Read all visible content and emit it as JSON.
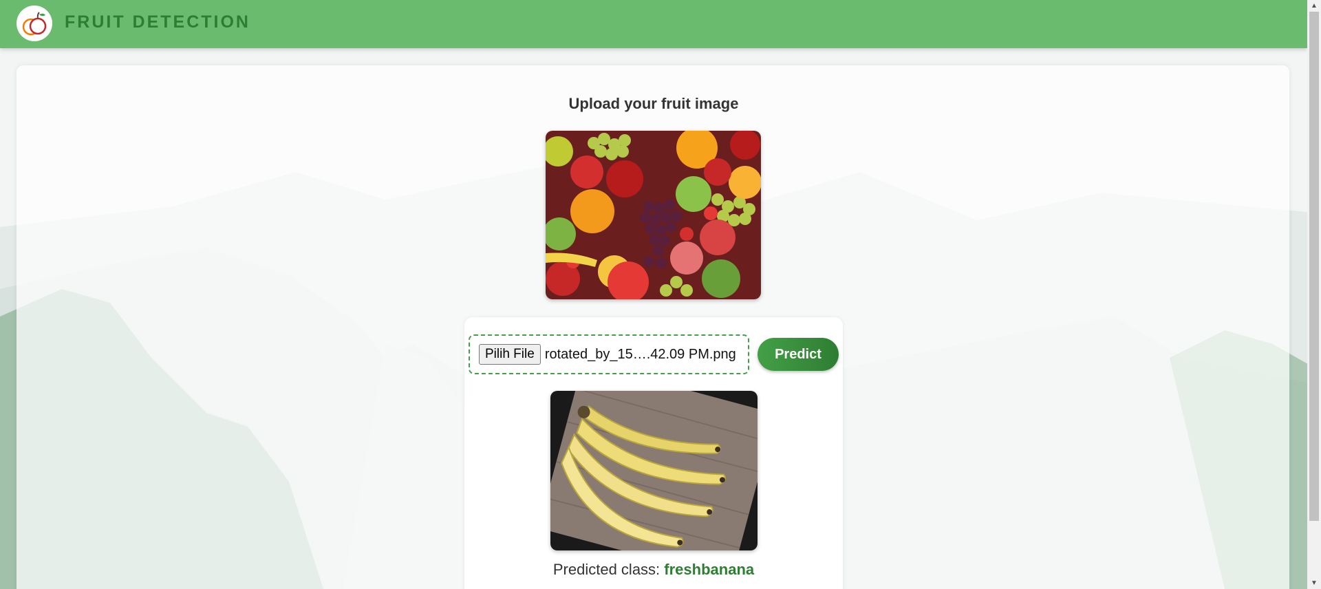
{
  "header": {
    "brand": "FRUIT DETECTION",
    "logo_icon": "apple-logo-icon"
  },
  "upload": {
    "title": "Upload your fruit image"
  },
  "form": {
    "file_button_label": "Pilih File",
    "file_name": "rotated_by_15….42.09 PM.png",
    "predict_label": "Predict"
  },
  "result": {
    "label": "Predicted class:",
    "value": "freshbanana"
  },
  "colors": {
    "header_bg": "#6abb6e",
    "brand": "#2e7d32",
    "accent": "#43a047"
  }
}
